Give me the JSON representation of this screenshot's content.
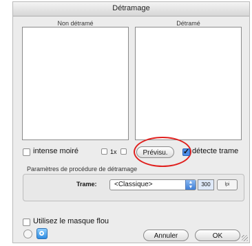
{
  "window": {
    "title": "Détramage"
  },
  "panes": {
    "left_label": "Non détramé",
    "right_label": "Détramé"
  },
  "options": {
    "intense_moire": {
      "label": "intense moiré",
      "checked": false
    },
    "zoom_label": "1x",
    "preview_button": "Prévisu.",
    "detect_trame": {
      "label": "détecte trame",
      "checked": true
    }
  },
  "procedure": {
    "group_label": "Paramètres de procédure de détramage",
    "trame_label": "Trame:",
    "trame_value": "<Classique>",
    "lpi_value": "300",
    "unit": "lpi"
  },
  "footer": {
    "mask_label": "Utilisez le masque flou",
    "mask_checked": false,
    "cancel_button": "Annuler",
    "ok_button": "OK"
  },
  "colors": {
    "accent": "#2e8be0",
    "highlight_ring": "#e0201e"
  }
}
